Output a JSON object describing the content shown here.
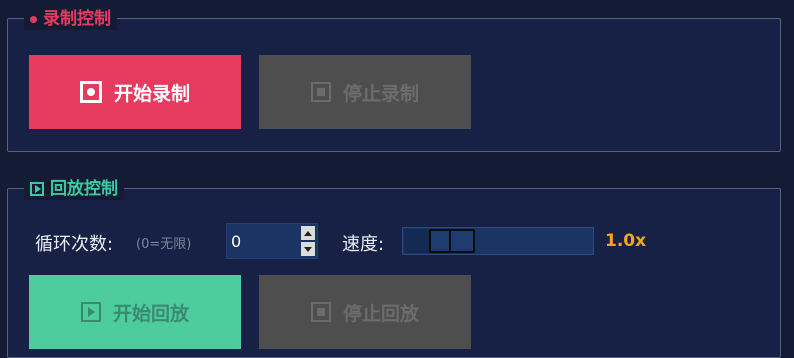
{
  "recording": {
    "title": "录制控制",
    "start_label": "开始录制",
    "stop_label": "停止录制"
  },
  "playback": {
    "title": "回放控制",
    "loop_label": "循环次数:",
    "loop_hint": "(0=无限)",
    "loop_value": "0",
    "speed_label": "速度:",
    "speed_value": "1.0x",
    "speed_level_fraction": 0.18,
    "start_label": "开始回放",
    "stop_label": "停止回放"
  },
  "colors": {
    "record_accent": "#e63b5e",
    "playback_accent": "#3dc9a0",
    "speed_value": "#f3a522",
    "disabled_button": "#4e4e4e"
  },
  "icons": {
    "record": "record-icon",
    "stop": "stop-icon",
    "play": "play-icon"
  }
}
